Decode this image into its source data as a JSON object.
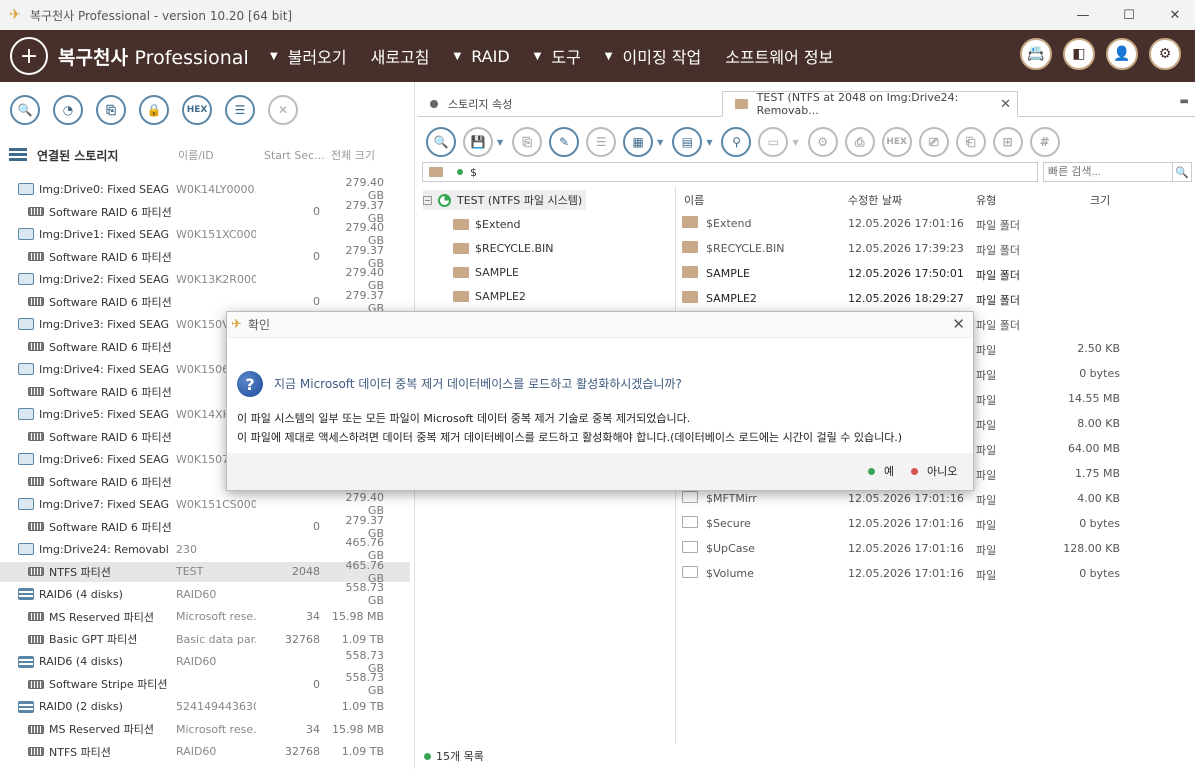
{
  "window": {
    "title": "복구천사 Professional - version 10.20 [64 bit]",
    "minimize": "—",
    "maximize": "☐",
    "close": "✕"
  },
  "menubar": {
    "brand_main": "복구천사",
    "brand_sub": "Professional",
    "items": [
      "불러오기",
      "새로고침",
      "RAID",
      "도구",
      "이미징 작업",
      "소프트웨어 정보"
    ],
    "arrows": [
      "▼",
      "",
      "▼",
      "▼",
      "▼",
      ""
    ],
    "icons": [
      "📇",
      "◧",
      "👤",
      "⚙"
    ]
  },
  "left_toolbar": {
    "buttons": [
      "🔍",
      "◔",
      "⎘",
      "🔒",
      "HEX",
      "☰",
      "✕"
    ]
  },
  "storage": {
    "title": "연결된 스토리지",
    "col_name": "이름/ID",
    "col_start": "Start Sec...",
    "col_size": "전체 크기",
    "rows": [
      {
        "name": "Img:Drive0: Fixed SEAG...",
        "id": "W0K14LY0000...",
        "sector": "",
        "size": "279.40 GB",
        "kind": "disk",
        "indent": 0
      },
      {
        "name": "Software RAID 6 파티션",
        "id": "",
        "sector": "0",
        "size": "279.37 GB",
        "kind": "part",
        "indent": 1
      },
      {
        "name": "Img:Drive1: Fixed SEAG...",
        "id": "W0K151XC000...",
        "sector": "",
        "size": "279.40 GB",
        "kind": "disk",
        "indent": 0
      },
      {
        "name": "Software RAID 6 파티션",
        "id": "",
        "sector": "0",
        "size": "279.37 GB",
        "kind": "part",
        "indent": 1
      },
      {
        "name": "Img:Drive2: Fixed SEAG...",
        "id": "W0K13K2R000...",
        "sector": "",
        "size": "279.40 GB",
        "kind": "disk",
        "indent": 0
      },
      {
        "name": "Software RAID 6 파티션",
        "id": "",
        "sector": "0",
        "size": "279.37 GB",
        "kind": "part",
        "indent": 1
      },
      {
        "name": "Img:Drive3: Fixed SEAG...",
        "id": "W0K150VF",
        "sector": "",
        "size": "",
        "kind": "disk",
        "indent": 0
      },
      {
        "name": "Software RAID 6 파티션",
        "id": "",
        "sector": "",
        "size": "",
        "kind": "part",
        "indent": 1
      },
      {
        "name": "Img:Drive4: Fixed SEAG...",
        "id": "W0K1506F",
        "sector": "",
        "size": "",
        "kind": "disk",
        "indent": 0
      },
      {
        "name": "Software RAID 6 파티션",
        "id": "",
        "sector": "",
        "size": "",
        "kind": "part",
        "indent": 1
      },
      {
        "name": "Img:Drive5: Fixed SEAG...",
        "id": "W0K14XH",
        "sector": "",
        "size": "",
        "kind": "disk",
        "indent": 0
      },
      {
        "name": "Software RAID 6 파티션",
        "id": "",
        "sector": "",
        "size": "",
        "kind": "part",
        "indent": 1
      },
      {
        "name": "Img:Drive6: Fixed SEAG...",
        "id": "W0K1507C",
        "sector": "",
        "size": "",
        "kind": "disk",
        "indent": 0
      },
      {
        "name": "Software RAID 6 파티션",
        "id": "",
        "sector": "",
        "size": "",
        "kind": "part",
        "indent": 1
      },
      {
        "name": "Img:Drive7: Fixed SEAG...",
        "id": "W0K151CS000...",
        "sector": "",
        "size": "279.40 GB",
        "kind": "disk",
        "indent": 0
      },
      {
        "name": "Software RAID 6 파티션",
        "id": "",
        "sector": "0",
        "size": "279.37 GB",
        "kind": "part",
        "indent": 1
      },
      {
        "name": "Img:Drive24: Removabl...",
        "id": "230",
        "sector": "",
        "size": "465.76 GB",
        "kind": "disk",
        "indent": 0
      },
      {
        "name": "NTFS 파티션",
        "id": "TEST",
        "sector": "2048",
        "size": "465.76 GB",
        "kind": "part",
        "indent": 1,
        "selected": true
      },
      {
        "name": "RAID6 (4 disks)",
        "id": "RAID60",
        "sector": "",
        "size": "558.73 GB",
        "kind": "raid",
        "indent": 0
      },
      {
        "name": "MS Reserved 파티션",
        "id": "Microsoft rese...",
        "sector": "34",
        "size": "15.98 MB",
        "kind": "part",
        "indent": 1
      },
      {
        "name": "Basic GPT 파티션",
        "id": "Basic data par...",
        "sector": "32768",
        "size": "1.09 TB",
        "kind": "part",
        "indent": 1
      },
      {
        "name": "RAID6 (4 disks)",
        "id": "RAID60",
        "sector": "",
        "size": "558.73 GB",
        "kind": "raid",
        "indent": 0
      },
      {
        "name": "Software Stripe 파티션",
        "id": "",
        "sector": "0",
        "size": "558.73 GB",
        "kind": "part",
        "indent": 1
      },
      {
        "name": "RAID0 (2 disks)",
        "id": "524149443630...",
        "sector": "",
        "size": "1.09 TB",
        "kind": "raid",
        "indent": 0
      },
      {
        "name": "MS Reserved 파티션",
        "id": "Microsoft rese...",
        "sector": "34",
        "size": "15.98 MB",
        "kind": "part",
        "indent": 1
      },
      {
        "name": "NTFS 파티션",
        "id": "RAID60",
        "sector": "32768",
        "size": "1.09 TB",
        "kind": "part",
        "indent": 1
      }
    ]
  },
  "tabs": [
    {
      "label": "스토리지 속성"
    },
    {
      "label": "TEST (NTFS at 2048 on Img:Drive24: Removab...",
      "close": "✕"
    }
  ],
  "right_toolbar": {
    "buttons": [
      "🔍",
      "💾",
      "⎘",
      "✎",
      "☰",
      "▦",
      "▤",
      "⚲",
      "▭",
      "⚙",
      "⎙",
      "HEX",
      "⎚",
      "⎗",
      "⊞",
      "#"
    ]
  },
  "path": {
    "value": "$"
  },
  "search": {
    "placeholder": "빠른 검색...",
    "icon": "🔍"
  },
  "folder_tree": {
    "root": "TEST (NTFS 파일 시스템)",
    "expander": "−",
    "children": [
      "$Extend",
      "$RECYCLE.BIN",
      "SAMPLE",
      "SAMPLE2"
    ]
  },
  "filelist": {
    "headers": {
      "name": "이름",
      "date": "수정한 날짜",
      "type": "유형",
      "size": "크기"
    },
    "rows": [
      {
        "name": "$Extend",
        "date": "12.05.2026 17:01:16",
        "type": "파일 폴더",
        "size": "",
        "folder": true
      },
      {
        "name": "$RECYCLE.BIN",
        "date": "12.05.2026 17:39:23",
        "type": "파일 폴더",
        "size": "",
        "folder": true
      },
      {
        "name": "SAMPLE",
        "date": "12.05.2026 17:50:01",
        "type": "파일 폴더",
        "size": "",
        "folder": true,
        "dark": true
      },
      {
        "name": "SAMPLE2",
        "date": "12.05.2026 18:29:27",
        "type": "파일 폴더",
        "size": "",
        "folder": true,
        "dark": true
      },
      {
        "name": "",
        "date": "",
        "type": "파일 폴더",
        "size": "",
        "folder": true
      },
      {
        "name": "",
        "date": "",
        "type": "파일",
        "size": "2.50 KB"
      },
      {
        "name": "",
        "date": "",
        "type": "파일",
        "size": "0 bytes"
      },
      {
        "name": "",
        "date": "",
        "type": "파일",
        "size": "14.55 MB"
      },
      {
        "name": "",
        "date": "",
        "type": "파일",
        "size": "8.00 KB"
      },
      {
        "name": "",
        "date": "",
        "type": "파일",
        "size": "64.00 MB"
      },
      {
        "name": "",
        "date": "",
        "type": "파일",
        "size": "1.75 MB"
      },
      {
        "name": "$MFTMirr",
        "date": "12.05.2026 17:01:16",
        "type": "파일",
        "size": "4.00 KB"
      },
      {
        "name": "$Secure",
        "date": "12.05.2026 17:01:16",
        "type": "파일",
        "size": "0 bytes"
      },
      {
        "name": "$UpCase",
        "date": "12.05.2026 17:01:16",
        "type": "파일",
        "size": "128.00 KB"
      },
      {
        "name": "$Volume",
        "date": "12.05.2026 17:01:16",
        "type": "파일",
        "size": "0 bytes"
      }
    ]
  },
  "status": {
    "text": "15개 목록"
  },
  "dialog": {
    "title": "확인",
    "close": "✕",
    "question_icon": "?",
    "heading": "지금 Microsoft 데이터 중복 제거 데이터베이스를 로드하고 활성화하시겠습니까?",
    "line1": "이 파일 시스템의 일부 또는 모든 파일이 Microsoft 데이터 중복 제거 기술로 중복 제거되었습니다.",
    "line2": "이 파일에 제대로 액세스하려면 데이터 중복 제거 데이터베이스를 로드하고 활성화해야 합니다.(데이터베이스 로드에는 시간이 걸릴 수 있습니다.)",
    "yes": "예",
    "no": "아니오",
    "yes_color": "#3aa655",
    "no_color": "#d9534f"
  }
}
